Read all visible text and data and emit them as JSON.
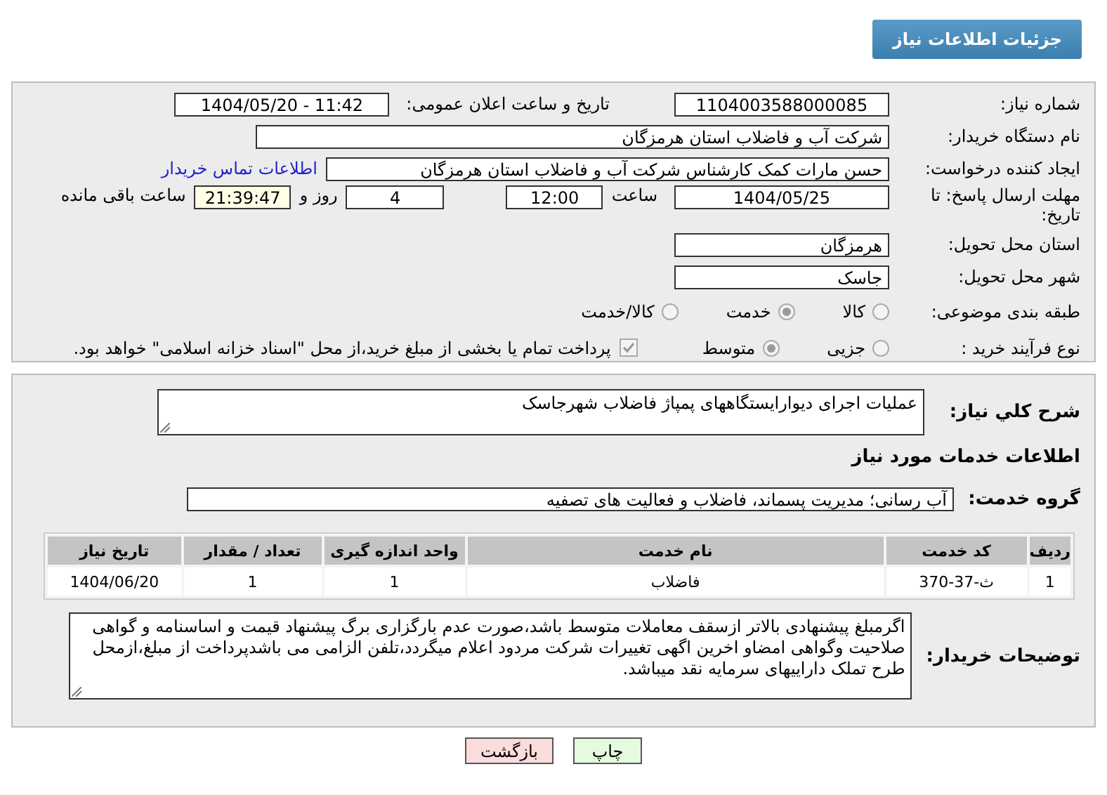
{
  "header": {
    "title": "جزئیات اطلاعات نیاز"
  },
  "details": {
    "need_number": {
      "label": "شماره نیاز:",
      "value": "1104003588000085"
    },
    "announce": {
      "label": "تاریخ و ساعت اعلان عمومی:",
      "value": "1404/05/20 - 11:42"
    },
    "buyer": {
      "label": "نام دستگاه خریدار:",
      "value": "شرکت آب و فاضلاب استان هرمزگان"
    },
    "creator": {
      "label": "ایجاد کننده درخواست:",
      "value": "حسن مارات کمک کارشناس شرکت آب و فاضلاب استان هرمزگان",
      "link": "اطلاعات تماس خریدار"
    },
    "deadline": {
      "label": "مهلت ارسال پاسخ: تا تاریخ:",
      "date": "1404/05/25",
      "time_label": "ساعت",
      "time": "12:00",
      "days": "4",
      "days_label": "روز و",
      "remaining": "21:39:47",
      "remaining_label": "ساعت باقی مانده"
    },
    "province": {
      "label": "استان محل تحویل:",
      "value": "هرمزگان"
    },
    "city": {
      "label": "شهر محل تحویل:",
      "value": "جاسک"
    },
    "category": {
      "label": "طبقه بندی موضوعی:",
      "options": [
        {
          "label": "کالا",
          "selected": false
        },
        {
          "label": "خدمت",
          "selected": true
        },
        {
          "label": "کالا/خدمت",
          "selected": false
        }
      ]
    },
    "process": {
      "label": "نوع فرآیند خرید :",
      "options": [
        {
          "label": "جزیی",
          "selected": false
        },
        {
          "label": "متوسط",
          "selected": true
        }
      ],
      "payment": {
        "label": "پرداخت تمام یا بخشی از مبلغ خرید،از محل \"اسناد خزانه اسلامی\" خواهد بود.",
        "checked": true
      }
    }
  },
  "need": {
    "description_label": "شرح کلي نياز:",
    "description": "عملیات اجرای دیوارایستگاههای پمپاژ فاضلاب شهرجاسک",
    "services_title": "اطلاعات خدمات مورد نیاز",
    "group_label": "گروه خدمت:",
    "group": "آب رسانی؛ مدیریت پسماند، فاضلاب و فعالیت های تصفیه",
    "table": {
      "columns": [
        "ردیف",
        "کد خدمت",
        "نام خدمت",
        "واحد اندازه گیری",
        "تعداد / مقدار",
        "تاریخ نیاز"
      ],
      "rows": [
        [
          "1",
          "ث-37-370",
          "فاضلاب",
          "1",
          "1",
          "1404/06/20"
        ]
      ]
    },
    "notes_label": "توضیحات خریدار:",
    "notes": "اگرمبلغ پیشنهادی بالاتر ازسقف معاملات متوسط باشد،صورت عدم بارگزاری برگ پیشنهاد قیمت و اساسنامه و گواهی صلاحیت وگواهی امضاو اخرین اگهی تغییرات شرکت مردود اعلام میگردد،تلفن الزامی می باشدپرداخت از مبلغ،ازمحل طرح تملک داراییهای سرمایه نقد میباشد."
  },
  "buttons": [
    {
      "label": "چاپ",
      "kind": "print"
    },
    {
      "label": "بازگشت",
      "kind": "back"
    }
  ]
}
